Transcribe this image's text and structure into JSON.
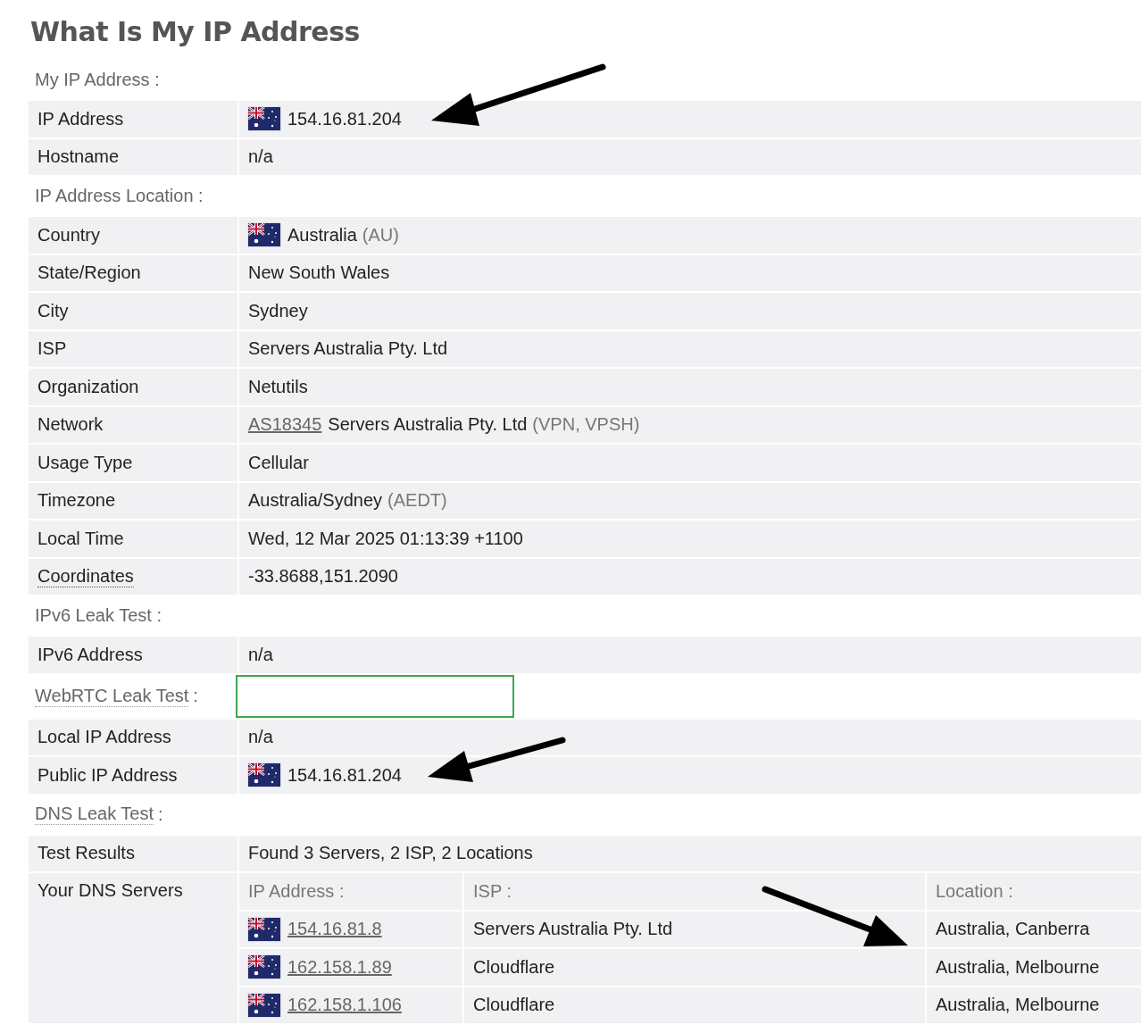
{
  "title": "What Is My IP Address",
  "sections": [
    {
      "heading": "My IP Address :",
      "rows": [
        {
          "label": "IP Address",
          "flag": true,
          "value": "154.16.81.204"
        },
        {
          "label": "Hostname",
          "value": "n/a"
        }
      ]
    },
    {
      "heading": "IP Address Location :",
      "rows": [
        {
          "label": "Country",
          "flag": true,
          "value": "Australia",
          "note": "(AU)"
        },
        {
          "label": "State/Region",
          "value": "New South Wales"
        },
        {
          "label": "City",
          "value": "Sydney"
        },
        {
          "label": "ISP",
          "value": "Servers Australia Pty. Ltd"
        },
        {
          "label": "Organization",
          "value": "Netutils"
        },
        {
          "label": "Network",
          "link": "AS18345",
          "value": "Servers Australia Pty. Ltd",
          "note": "(VPN, VPSH)"
        },
        {
          "label": "Usage Type",
          "value": "Cellular"
        },
        {
          "label": "Timezone",
          "value": "Australia/Sydney",
          "note": "(AEDT)"
        },
        {
          "label": "Local Time",
          "value": "Wed, 12 Mar 2025 01:13:39 +1100"
        },
        {
          "label": "Coordinates",
          "label_tooltip": true,
          "value": "-33.8688,151.2090"
        }
      ]
    },
    {
      "heading": "IPv6 Leak Test :",
      "rows": [
        {
          "label": "IPv6 Address",
          "value": "n/a"
        }
      ]
    },
    {
      "heading": "WebRTC Leak Test",
      "heading_suffix": ":",
      "has_tooltip": true,
      "status_box": true,
      "rows": [
        {
          "label": "Local IP Address",
          "value": "n/a"
        },
        {
          "label": "Public IP Address",
          "flag": true,
          "value": "154.16.81.204"
        }
      ]
    },
    {
      "heading": "DNS Leak Test",
      "heading_suffix": ":",
      "has_tooltip": true,
      "rows": [
        {
          "label": "Test Results",
          "value": "Found 3 Servers, 2 ISP, 2 Locations"
        }
      ]
    }
  ],
  "dns": {
    "label": "Your DNS Servers",
    "columns": [
      "IP Address :",
      "ISP :",
      "Location :"
    ],
    "rows": [
      {
        "ip": "154.16.81.8",
        "isp": "Servers Australia Pty. Ltd",
        "location": "Australia, Canberra"
      },
      {
        "ip": "162.158.1.89",
        "isp": "Cloudflare",
        "location": "Australia, Melbourne"
      },
      {
        "ip": "162.158.1.106",
        "isp": "Cloudflare",
        "location": "Australia, Melbourne"
      }
    ]
  }
}
